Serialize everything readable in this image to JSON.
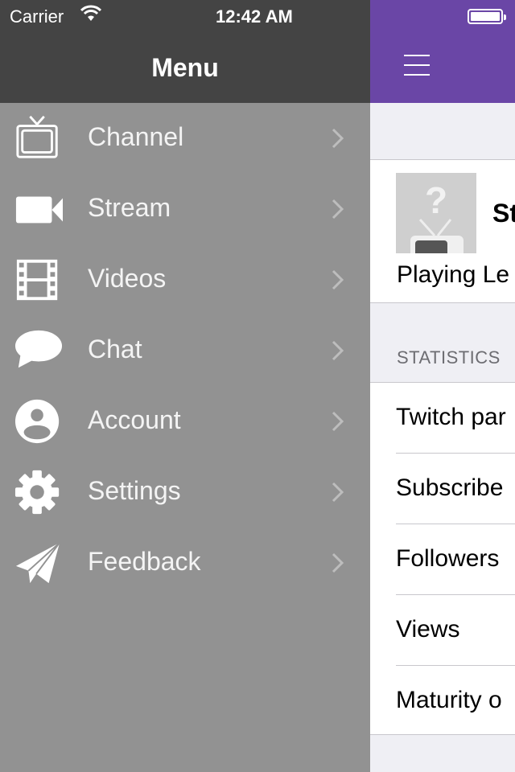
{
  "status_bar": {
    "carrier": "Carrier",
    "time": "12:42 AM"
  },
  "menu": {
    "title": "Menu",
    "items": [
      {
        "label": "Channel",
        "icon": "tv-icon"
      },
      {
        "label": "Stream",
        "icon": "video-camera-icon"
      },
      {
        "label": "Videos",
        "icon": "film-icon"
      },
      {
        "label": "Chat",
        "icon": "chat-bubble-icon"
      },
      {
        "label": "Account",
        "icon": "account-icon"
      },
      {
        "label": "Settings",
        "icon": "gear-icon"
      },
      {
        "label": "Feedback",
        "icon": "paper-plane-icon"
      }
    ]
  },
  "main": {
    "channel_name": "St",
    "game": "Playing Le",
    "section_header": "STATISTICS",
    "stats": [
      "Twitch par",
      "Subscribe",
      "Followers",
      "Views",
      "Maturity o"
    ]
  },
  "colors": {
    "accent": "#6a46a6",
    "menu_bg": "#929292",
    "menu_header": "#444444"
  }
}
